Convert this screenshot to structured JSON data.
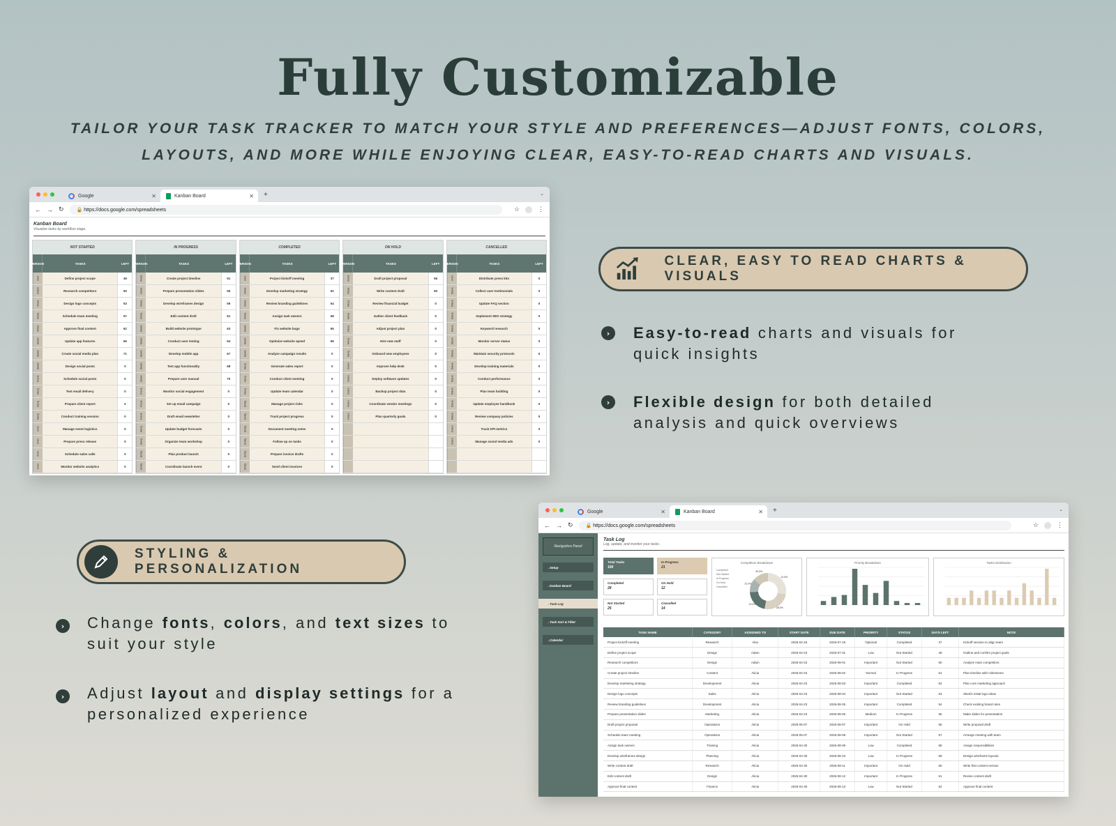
{
  "header": {
    "title": "Fully Customizable",
    "subtitle_line1": "TAILOR YOUR TASK TRACKER TO MATCH YOUR STYLE AND PREFERENCES—ADJUST FONTS, COLORS,",
    "subtitle_line2": "LAYOUTS, AND MORE WHILE ENJOYING CLEAR, EASY-TO-READ CHARTS AND VISUALS."
  },
  "browser": {
    "tab1": "Google",
    "tab2": "Kanban Board",
    "url": "https://docs.google.com/spreadsheets"
  },
  "kanban": {
    "title": "Kanban Board",
    "subtitle": "Visualize tasks by workflow stage.",
    "col_person": "PERSON",
    "col_tasks": "TASKS",
    "col_left": "LEFT",
    "columns": [
      {
        "status": "NOT STARTED",
        "rows": [
          [
            "Alex",
            "Define project scope",
            "49"
          ],
          [
            "Adam",
            "Research competitors",
            "50"
          ],
          [
            "Alicia",
            "Design logo concepts",
            "53"
          ],
          [
            "Alicia",
            "Schedule team meeting",
            "57"
          ],
          [
            "Alicia",
            "Approve final content",
            "62"
          ],
          [
            "David",
            "Update app features",
            "66"
          ],
          [
            "David",
            "Create social media plan",
            "71"
          ],
          [
            "David",
            "Design social posts",
            "0"
          ],
          [
            "Frank",
            "Schedule social posts",
            "0"
          ],
          [
            "Harry",
            "Test email delivery",
            "0"
          ],
          [
            "Harry",
            "Prepare client report",
            "0"
          ],
          [
            "Harry",
            "Conduct training session",
            "0"
          ],
          [
            "Ariel",
            "Manage event logistics",
            "0"
          ],
          [
            "Ariel",
            "Prepare press release",
            "0"
          ],
          [
            "Ariel",
            "Schedule sales calls",
            "0"
          ],
          [
            "Ariel",
            "Monitor website analytics",
            "0"
          ]
        ]
      },
      {
        "status": "IN PROGRESS",
        "rows": [
          [
            "Alicia",
            "Create project timeline",
            "51"
          ],
          [
            "Alicia",
            "Prepare presentation slides",
            "55"
          ],
          [
            "Alicia",
            "Develop wireframes design",
            "59"
          ],
          [
            "Alicia",
            "Edit content draft",
            "61"
          ],
          [
            "David",
            "Build website prototype",
            "63"
          ],
          [
            "David",
            "Conduct user testing",
            "64"
          ],
          [
            "David",
            "Develop mobile app",
            "67"
          ],
          [
            "David",
            "Test app functionality",
            "68"
          ],
          [
            "David",
            "Prepare user manual",
            "70"
          ],
          [
            "Frank",
            "Monitor social engagement",
            "0"
          ],
          [
            "Frank",
            "Set up email campaign",
            "0"
          ],
          [
            "Frank",
            "Draft email newsletter",
            "0"
          ],
          [
            "Harry",
            "Update budget forecasts",
            "0"
          ],
          [
            "Harry",
            "Organize team workshop",
            "0"
          ],
          [
            "Emily",
            "Plan product launch",
            "0"
          ],
          [
            "Emily",
            "Coordinate launch event",
            "0"
          ]
        ]
      },
      {
        "status": "COMPLETED",
        "rows": [
          [
            "Alex",
            "Project kickoff meeting",
            "37"
          ],
          [
            "Alicia",
            "Develop marketing strategy",
            "52"
          ],
          [
            "Alicia",
            "Review branding guidelines",
            "54"
          ],
          [
            "Alicia",
            "Assign task owners",
            "58"
          ],
          [
            "David",
            "Fix website bugs",
            "65"
          ],
          [
            "David",
            "Optimize website speed",
            "69"
          ],
          [
            "David",
            "Analyze campaign results",
            "0"
          ],
          [
            "Harry",
            "Generate sales report",
            "0"
          ],
          [
            "Harry",
            "Conduct client meeting",
            "0"
          ],
          [
            "Harry",
            "Update team calendar",
            "0"
          ],
          [
            "Emily",
            "Manage project risks",
            "0"
          ],
          [
            "Emily",
            "Track project progress",
            "0"
          ],
          [
            "Emily",
            "Document meeting notes",
            "0"
          ],
          [
            "Emily",
            "Follow up on tasks",
            "0"
          ],
          [
            "Emily",
            "Prepare invoice drafts",
            "0"
          ],
          [
            "Emily",
            "Send client invoices",
            "0"
          ]
        ]
      },
      {
        "status": "ON HOLD",
        "rows": [
          [
            "Alicia",
            "Draft project proposal",
            "56"
          ],
          [
            "Alicia",
            "Write content draft",
            "60"
          ],
          [
            "Harry",
            "Review financial budget",
            "0"
          ],
          [
            "Harry",
            "Gather client feedback",
            "0"
          ],
          [
            "Harry",
            "Adjust project plan",
            "0"
          ],
          [
            "Harry",
            "Hire new staff",
            "0"
          ],
          [
            "Harry",
            "Onboard new employees",
            "0"
          ],
          [
            "Grace",
            "Improve help desk",
            "0"
          ],
          [
            "Grace",
            "Deploy software updates",
            "0"
          ],
          [
            "Grace",
            "Backup project data",
            "0"
          ],
          [
            "Grace",
            "Coordinate vendor meetings",
            "0"
          ],
          [
            "Grace",
            "Plan quarterly goals",
            "0"
          ],
          [
            "",
            "",
            ""
          ],
          [
            "",
            "",
            ""
          ],
          [
            "",
            "",
            ""
          ],
          [
            "",
            "",
            ""
          ]
        ]
      },
      {
        "status": "CANCELLED",
        "rows": [
          [
            "Ariel",
            "Distribute press kits",
            "0"
          ],
          [
            "Diana",
            "Collect user testimonials",
            "0"
          ],
          [
            "Diana",
            "Update FAQ section",
            "0"
          ],
          [
            "Diana",
            "Implement SEO strategy",
            "0"
          ],
          [
            "Diana",
            "Keyword research",
            "0"
          ],
          [
            "Diana",
            "Monitor server status",
            "0"
          ],
          [
            "Diana",
            "Maintain security protocols",
            "0"
          ],
          [
            "Diana",
            "Develop training materials",
            "0"
          ],
          [
            "Diana",
            "Conduct performance",
            "0"
          ],
          [
            "Diana",
            "Plan team building",
            "0"
          ],
          [
            "Diana",
            "Update employee handbook",
            "0"
          ],
          [
            "Diana",
            "Review company policies",
            "0"
          ],
          [
            "Grace",
            "Track KPI metrics",
            "0"
          ],
          [
            "Grace",
            "Manage social media ads",
            "0"
          ],
          [
            "",
            "",
            ""
          ],
          [
            "",
            "",
            ""
          ]
        ]
      }
    ]
  },
  "feature1": {
    "pill_label": "CLEAR, EASY TO READ CHARTS & VISUALS",
    "pill_icon": "chart-growth-icon",
    "b1_bold": "Easy-to-read",
    "b1_rest1": " charts and visuals for",
    "b1_rest2": "quick insights",
    "b2_bold": "Flexible design",
    "b2_rest1": " for both detailed",
    "b2_rest2": "analysis and quick overviews"
  },
  "feature2": {
    "pill_label": "STYLING & PERSONALIZATION",
    "pill_icon": "pencil-icon",
    "b1_a": "Change ",
    "b1_fonts": "fonts",
    "b1_c1": ", ",
    "b1_colors": "colors",
    "b1_c2": ", and ",
    "b1_sizes": "text sizes",
    "b1_end": " to",
    "b1_line2": "suit your style",
    "b2_a": "Adjust ",
    "b2_layout": "layout",
    "b2_and": " and ",
    "b2_display": "display settings",
    "b2_end": " for a",
    "b2_line2": "personalized experience"
  },
  "tasklog": {
    "nav_panel": "Navigation Panel",
    "nav_items": [
      "Setup",
      "Kanban Board",
      "Task Log",
      "Task Sort & Filter",
      "Calendar"
    ],
    "title": "Task Log",
    "subtitle": "Log, update, and monitor your tasks.",
    "kpis": [
      {
        "label": "Total Tasks",
        "value": "100"
      },
      {
        "label": "In Progress",
        "value": "21"
      },
      {
        "label": "Completed",
        "value": "28"
      },
      {
        "label": "On Hold",
        "value": "12"
      },
      {
        "label": "Not Started",
        "value": "25"
      },
      {
        "label": "Cancelled",
        "value": "14"
      }
    ],
    "chart_titles": [
      "Completion Breakdown",
      "Priority Breakdown",
      "Tasks Distribution"
    ],
    "donut_legend": [
      "Completed",
      "Not Started",
      "In Progress",
      "On Hold",
      "Cancelled"
    ],
    "donut_labels": [
      "14.0%",
      "28.0%",
      "12.0%",
      "21.0%",
      "25.0%"
    ],
    "headers": [
      "TASK NAME",
      "CATEGORY",
      "ASSIGNED TO",
      "START DATE",
      "DUE DATE",
      "PRIORITY",
      "STATUS",
      "DAYS LEFT",
      "NOTE"
    ],
    "rows": [
      [
        "Project kickoff meeting",
        "Research",
        "Alex",
        "2026-04-18",
        "2026-07-19",
        "Optional",
        "Completed",
        "37",
        "Kickoff session to align team"
      ],
      [
        "Define project scope",
        "Design",
        "Adam",
        "2026-04-23",
        "2026-07-31",
        "Low",
        "Not Started",
        "49",
        "Outline and confirm project goals"
      ],
      [
        "Research competitors",
        "Design",
        "Adam",
        "2026-04-23",
        "2026-08-01",
        "Important",
        "Not Started",
        "50",
        "Analyze main competitors"
      ],
      [
        "Create project timeline",
        "Content",
        "Alicia",
        "2026-04-23",
        "2026-08-02",
        "Normal",
        "In Progress",
        "51",
        "Plan timeline with milestones"
      ],
      [
        "Develop marketing strategy",
        "Development",
        "Alicia",
        "2026-04-23",
        "2026-08-03",
        "Important",
        "Completed",
        "52",
        "Plan core marketing approach"
      ],
      [
        "Design logo concepts",
        "Sales",
        "Alicia",
        "2026-04-23",
        "2026-08-04",
        "Important",
        "Not Started",
        "53",
        "Sketch initial logo ideas"
      ],
      [
        "Review branding guidelines",
        "Development",
        "Alicia",
        "2026-04-23",
        "2026-08-05",
        "Important",
        "Completed",
        "54",
        "Check existing brand rules"
      ],
      [
        "Prepare presentation slides",
        "Marketing",
        "Alicia",
        "2026-04-23",
        "2026-08-06",
        "Medium",
        "In Progress",
        "55",
        "Make slides for presentation"
      ],
      [
        "Draft project proposal",
        "Operations",
        "Alicia",
        "2026-05-07",
        "2026-08-07",
        "Important",
        "On Hold",
        "56",
        "Write proposal draft"
      ],
      [
        "Schedule team meeting",
        "Operations",
        "Alicia",
        "2026-05-07",
        "2026-08-08",
        "Important",
        "Not Started",
        "57",
        "Arrange meeting with team"
      ],
      [
        "Assign task owners",
        "Training",
        "Alicia",
        "2026-04-30",
        "2026-08-09",
        "Low",
        "Completed",
        "58",
        "Assign responsibilities"
      ],
      [
        "Develop wireframes design",
        "Planning",
        "Alicia",
        "2026-04-30",
        "2026-08-10",
        "Low",
        "In Progress",
        "59",
        "Design wireframe layouts"
      ],
      [
        "Write content draft",
        "Research",
        "Alicia",
        "2026-04-30",
        "2026-08-11",
        "Important",
        "On Hold",
        "60",
        "Write first content version"
      ],
      [
        "Edit content draft",
        "Design",
        "Alicia",
        "2026-04-30",
        "2026-08-12",
        "Important",
        "In Progress",
        "61",
        "Revise content draft"
      ],
      [
        "Approve final content",
        "Finance",
        "Alicia",
        "2026-04-30",
        "2026-08-13",
        "Low",
        "Not Started",
        "62",
        "Approve final content"
      ]
    ]
  },
  "chart_data": [
    {
      "type": "pie",
      "title": "Completion Breakdown",
      "categories": [
        "Completed",
        "Not Started",
        "In Progress",
        "On Hold",
        "Cancelled"
      ],
      "values": [
        28,
        25,
        21,
        12,
        14
      ]
    },
    {
      "type": "bar",
      "title": "Priority Breakdown",
      "values": [
        2,
        4,
        5,
        18,
        10,
        6,
        12,
        2,
        1,
        1
      ]
    },
    {
      "type": "bar",
      "title": "Tasks Distribution",
      "values": [
        1,
        1,
        1,
        2,
        1,
        2,
        2,
        1,
        2,
        1,
        3,
        2,
        1,
        5,
        1
      ]
    }
  ],
  "colors": {
    "accent_dark": "#2f3e3b",
    "pill_tan": "#d9c9b0",
    "sheet_header": "#5c726d"
  }
}
